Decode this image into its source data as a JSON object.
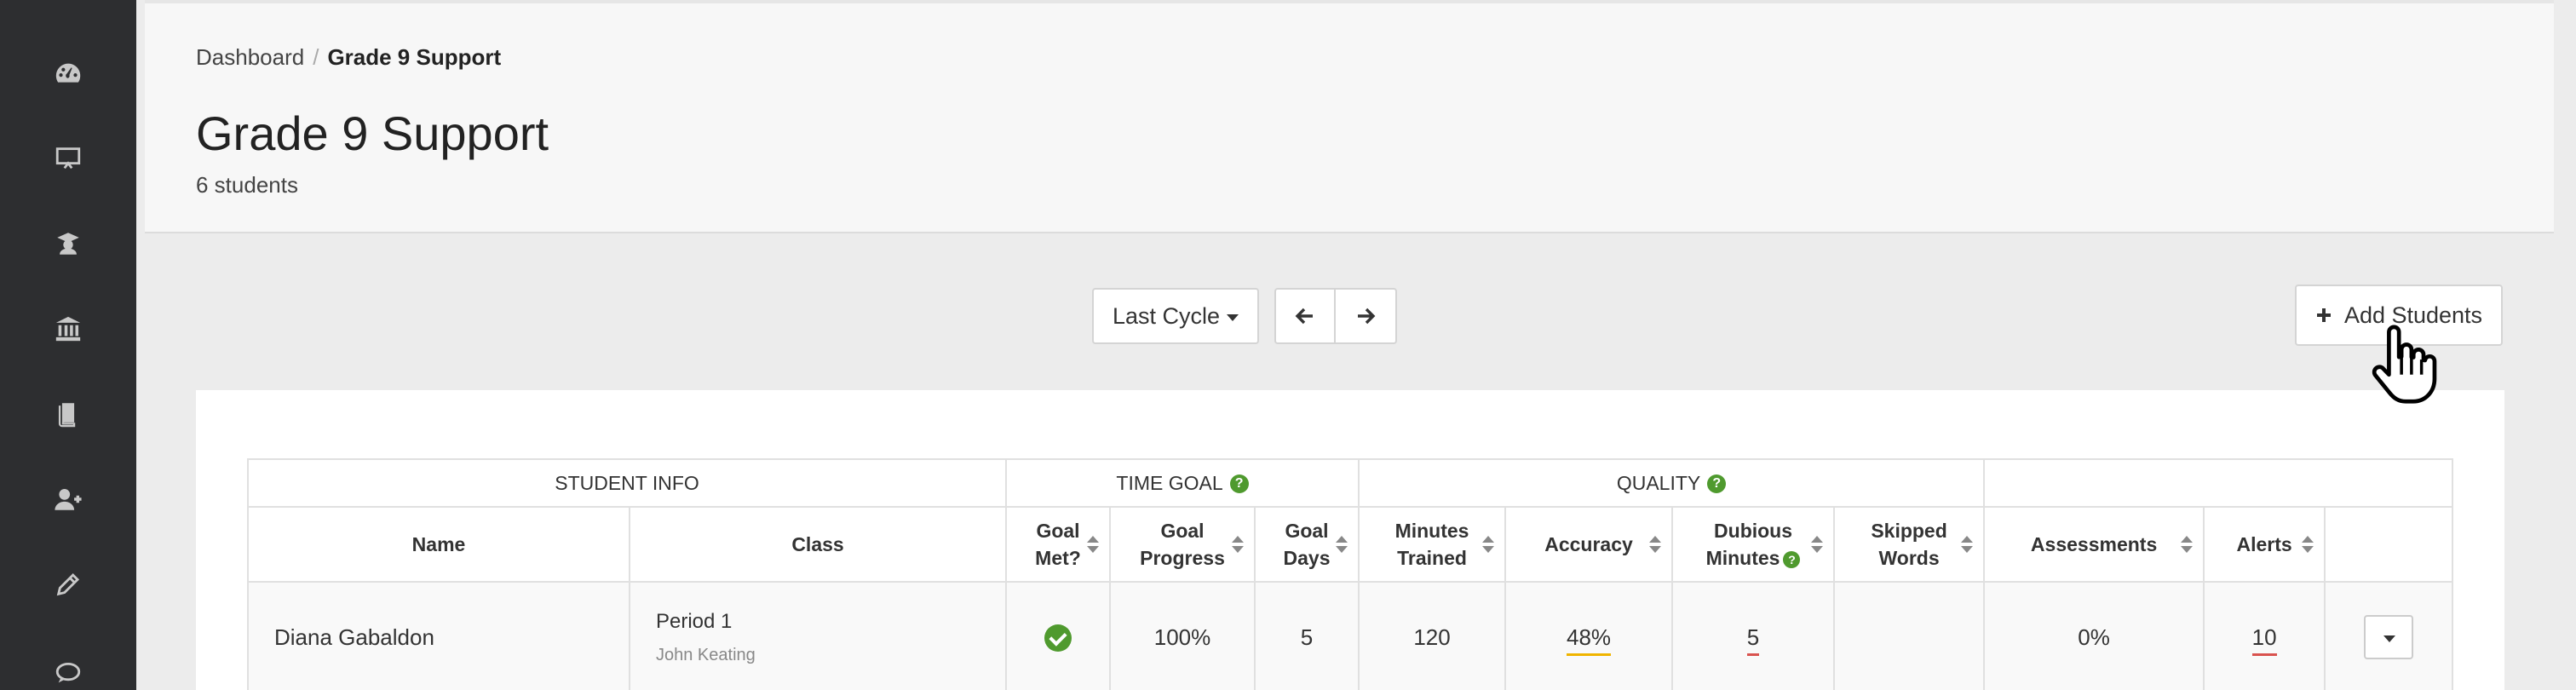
{
  "sidebar": {
    "items": [
      {
        "icon": "dashboard-icon"
      },
      {
        "icon": "presentation-icon"
      },
      {
        "icon": "graduate-icon"
      },
      {
        "icon": "institution-icon"
      },
      {
        "icon": "book-icon"
      },
      {
        "icon": "add-user-icon"
      },
      {
        "icon": "pencil-icon"
      },
      {
        "icon": "comment-icon"
      }
    ]
  },
  "breadcrumb": {
    "parent": "Dashboard",
    "separator": "/",
    "current": "Grade 9 Support"
  },
  "header": {
    "title": "Grade 9 Support",
    "subtitle": "6 students"
  },
  "toolbar": {
    "cycle_label": "Last Cycle",
    "prev_icon": "arrow-left-icon",
    "next_icon": "arrow-right-icon",
    "add_students_label": "Add Students"
  },
  "table": {
    "groups": {
      "student_info": "STUDENT INFO",
      "time_goal": "TIME GOAL",
      "quality": "QUALITY"
    },
    "columns": {
      "name": "Name",
      "class": "Class",
      "goal_met_1": "Goal",
      "goal_met_2": "Met?",
      "goal_progress_1": "Goal",
      "goal_progress_2": "Progress",
      "goal_days_1": "Goal",
      "goal_days_2": "Days",
      "minutes_trained_1": "Minutes",
      "minutes_trained_2": "Trained",
      "accuracy": "Accuracy",
      "dubious_1": "Dubious",
      "dubious_2": "Minutes",
      "skipped_1": "Skipped",
      "skipped_2": "Words",
      "assessments": "Assessments",
      "alerts": "Alerts"
    },
    "rows": [
      {
        "name": "Diana Gabaldon",
        "class": "Period 1",
        "teacher": "John Keating",
        "goal_met": true,
        "goal_progress": "100%",
        "goal_days": "5",
        "minutes_trained": "120",
        "accuracy": "48%",
        "dubious_minutes": "5",
        "skipped_words": "",
        "assessments": "0%",
        "alerts": "10"
      }
    ]
  },
  "colors": {
    "sidebar_bg": "#2d2e30",
    "accent_green": "#4f9a2e",
    "warn_yellow": "#f0b400",
    "alert_red": "#d9534f"
  }
}
